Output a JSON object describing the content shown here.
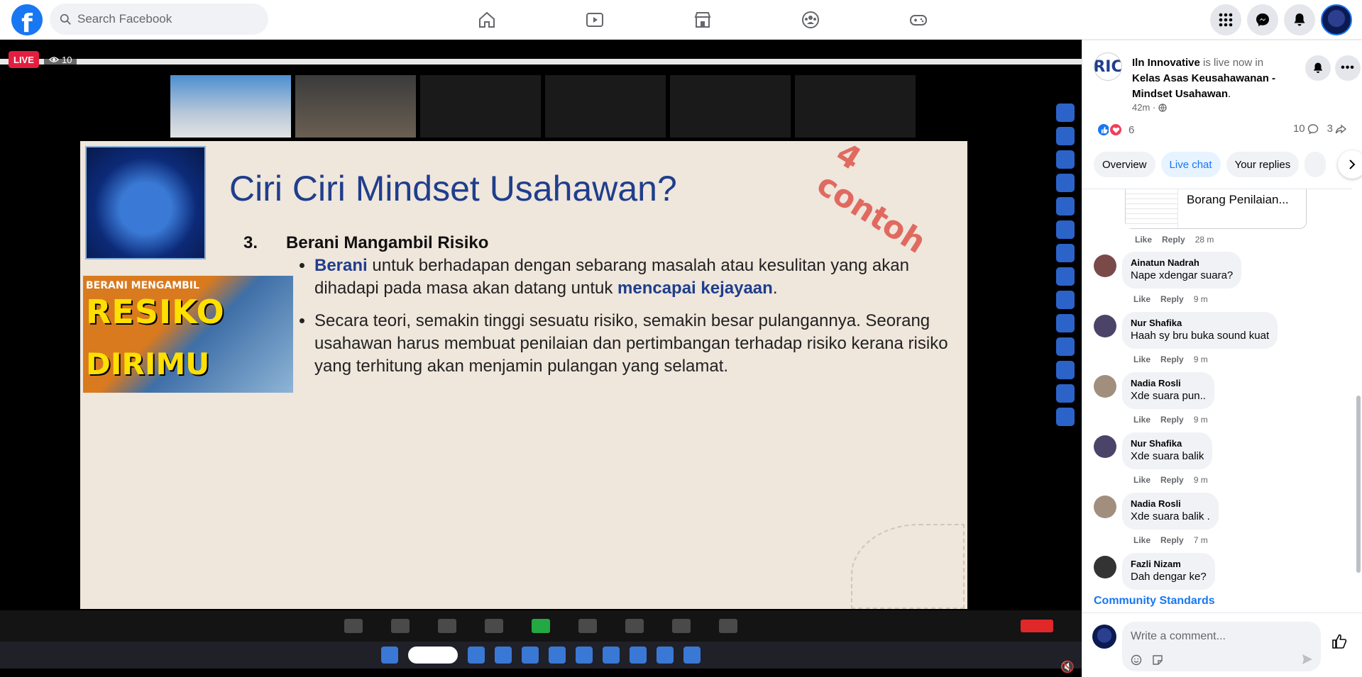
{
  "topbar": {
    "logo_letter": "f",
    "search_placeholder": "Search Facebook",
    "nav": [
      "home-icon",
      "video-icon",
      "marketplace-icon",
      "groups-icon",
      "gaming-icon"
    ],
    "right": [
      "menu-grid-icon",
      "messenger-icon",
      "notifications-icon",
      "profile-avatar"
    ]
  },
  "video": {
    "live_label": "LIVE",
    "viewer_count": "10"
  },
  "slide": {
    "title": "Ciri Ciri Mindset Usahawan?",
    "stamp": "4 contoh",
    "heading_number": "3.",
    "heading_text": "Berani Mangambil Risiko",
    "bullets": [
      {
        "highlight": "Berani",
        "text": " untuk berhadapan dengan sebarang masalah atau kesulitan yang akan dihadapi pada masa akan datang untuk ",
        "highlight2": "mencapai kejayaan",
        "end": "."
      },
      {
        "highlight": "",
        "text": "Secara teori, semakin tinggi sesuatu risiko, semakin besar pulangannya. Seorang usahawan harus membuat penilaian dan pertimbangan terhadap risiko kerana risiko yang terhitung  akan menjamin pulangan yang selamat.",
        "highlight2": "",
        "end": ""
      }
    ],
    "image_caption_1": "BERANI MENGAMBIL",
    "image_caption_2": "RESIKO",
    "image_caption_3": "DIRIMU"
  },
  "post": {
    "page_name": "Iln Innovative",
    "status": " is live now in ",
    "group": "Kelas Asas Keusahawanan - Mindset Usahawan",
    "group_end": ".",
    "time": "42m ·",
    "reaction_count": "6",
    "comment_count": "10",
    "share_count": "3",
    "tabs": [
      "Overview",
      "Live chat",
      "Your replies"
    ],
    "active_tab": "Live chat"
  },
  "comments": {
    "attachment_title": "Borang Penilaian...",
    "first_actions": {
      "like": "Like",
      "reply": "Reply",
      "time": "28 m"
    },
    "items": [
      {
        "name": "Ainatun Nadrah",
        "text": "Nape xdengar suara?",
        "like": "Like",
        "reply": "Reply",
        "time": "9 m",
        "color": "#7a4a4a"
      },
      {
        "name": "Nur Shafika",
        "text": "Haah sy bru buka sound kuat",
        "like": "Like",
        "reply": "Reply",
        "time": "9 m",
        "color": "#4b4368"
      },
      {
        "name": "Nadia Rosli",
        "text": "Xde suara pun..",
        "like": "Like",
        "reply": "Reply",
        "time": "9 m",
        "color": "#a28e7d"
      },
      {
        "name": "Nur Shafika",
        "text": "Xde suara balik",
        "like": "Like",
        "reply": "Reply",
        "time": "9 m",
        "color": "#4b4368"
      },
      {
        "name": "Nadia Rosli",
        "text": "Xde suara balik .",
        "like": "Like",
        "reply": "Reply",
        "time": "7 m",
        "color": "#a28e7d"
      },
      {
        "name": "Fazli Nizam",
        "text": "Dah dengar ke?",
        "like": "",
        "reply": "",
        "time": "",
        "color": "#333333"
      }
    ],
    "community_standards": "Community Standards"
  },
  "composer": {
    "placeholder": "Write a comment..."
  }
}
